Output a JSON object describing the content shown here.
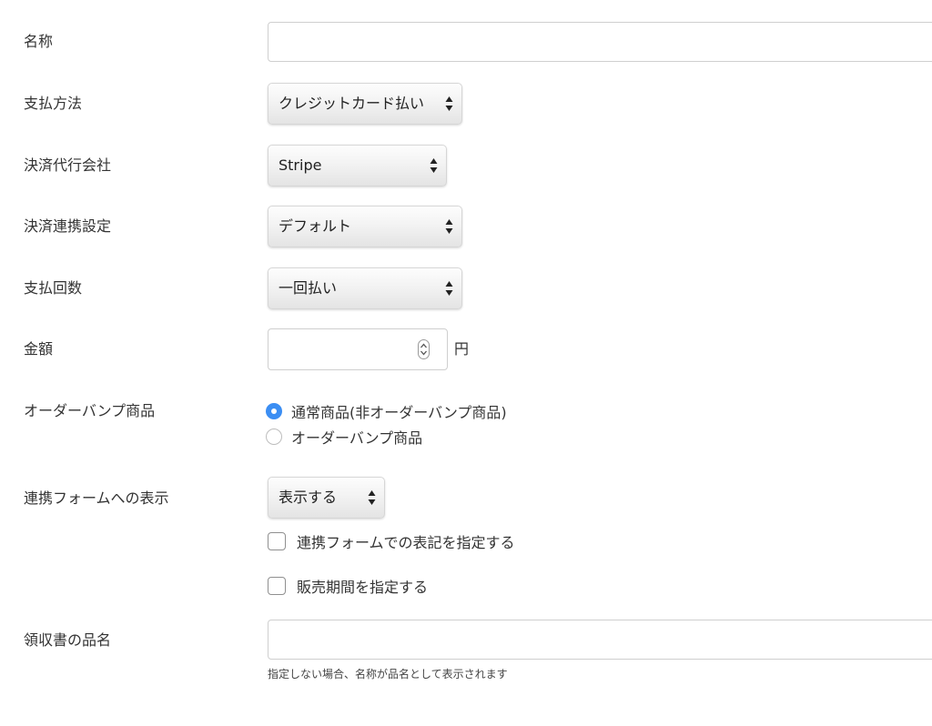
{
  "fields": {
    "name": {
      "label": "名称",
      "value": ""
    },
    "payment_method": {
      "label": "支払方法",
      "selected": "クレジットカード払い"
    },
    "gateway": {
      "label": "決済代行会社",
      "selected": "Stripe"
    },
    "integration": {
      "label": "決済連携設定",
      "selected": "デフォルト"
    },
    "installments": {
      "label": "支払回数",
      "selected": "一回払い"
    },
    "amount": {
      "label": "金額",
      "value": "",
      "unit": "円"
    },
    "order_bump": {
      "label": "オーダーバンプ商品",
      "options": [
        {
          "label": "通常商品(非オーダーバンプ商品)",
          "checked": true
        },
        {
          "label": "オーダーバンプ商品",
          "checked": false
        }
      ]
    },
    "form_display": {
      "label": "連携フォームへの表示",
      "selected": "表示する",
      "checkbox_notation": "連携フォームでの表記を指定する",
      "checkbox_sales_period": "販売期間を指定する"
    },
    "receipt_name": {
      "label": "領収書の品名",
      "value": "",
      "help": "指定しない場合、名称が品名として表示されます"
    }
  },
  "colors": {
    "accent": "#3b8ef3",
    "border": "#cfcfcf",
    "text": "#333333"
  }
}
